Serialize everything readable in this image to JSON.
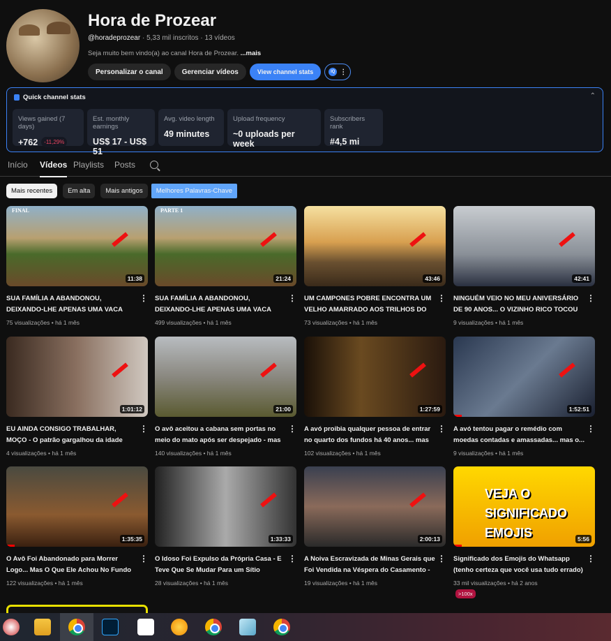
{
  "channel": {
    "name": "Hora de Prozear",
    "handle": "@horadeprozear",
    "subs": " · 5,33 mil inscritos · 13 vídeos",
    "description": "Seja muito bem vindo(a) ao canal Hora de Prozear. ",
    "more": "...mais"
  },
  "buttons": {
    "customize": "Personalizar o canal",
    "manage": "Gerenciar vídeos",
    "stats": "View channel stats",
    "vq": "IQ",
    "more": "⋮"
  },
  "stats": {
    "title": "Quick channel stats",
    "cards": [
      {
        "label": "Views gained (7 days)",
        "value": "+762",
        "badge": "-11,29%"
      },
      {
        "label": "Est. monthly earnings",
        "value": "US$ 17 - US$ 51"
      },
      {
        "label": "Avg. video length",
        "value": "49 minutes"
      },
      {
        "label": "Upload frequency",
        "value": "~0 uploads per week"
      },
      {
        "label": "Subscribers rank",
        "value": "#4,5 mi"
      }
    ]
  },
  "tabs": [
    "Início",
    "Vídeos",
    "Playlists",
    "Posts"
  ],
  "chips": [
    "Mais recentes",
    "Em alta",
    "Mais antigos",
    "Melhores Palavras-Chave"
  ],
  "videos": [
    {
      "title": "SUA FAMÍLIA A ABANDONOU, DEIXANDO-LHE APENAS UMA VACA COMO HERANÇA...",
      "meta": "75 visualizações • há 1 mês",
      "duration": "11:38",
      "label": "FINAL"
    },
    {
      "title": "SUA FAMÍLIA A ABANDONOU, DEIXANDO-LHE APENAS UMA VACA COMO HERANÇA...",
      "meta": "499 visualizações • há 1 mês",
      "duration": "21:24",
      "label": "PARTE 1"
    },
    {
      "title": "UM CAMPONES POBRE ENCONTRA UM VELHO AMARRADO AOS TRILHOS DO TRE...",
      "meta": "73 visualizações • há 1 mês",
      "duration": "43:46"
    },
    {
      "title": "NINGUÉM VEIO NO MEU ANIVERSÁRIO DE 90 ANOS... O VIZINHO RICO TOCOU A...",
      "meta": "9 visualizações • há 1 mês",
      "duration": "42:41"
    },
    {
      "title": "EU AINDA CONSIGO TRABALHAR, MOÇO - O patrão gargalhou da idade dele... até ver o...",
      "meta": "4 visualizações • há 1 mês",
      "duration": "1:01:12"
    },
    {
      "title": "O avô aceitou a cabana sem portas no meio do mato após ser despejado - mas o motiv...",
      "meta": "140 visualizações • há 1 mês",
      "duration": "21:00"
    },
    {
      "title": "A avó proibia qualquer pessoa de entrar no quarto dos fundos há 40 anos... mas quand...",
      "meta": "102 visualizações • há 1 mês",
      "duration": "1:27:59"
    },
    {
      "title": "A avó tentou pagar o remédio com moedas contadas e amassadas... mas o...",
      "meta": "9 visualizações • há 1 mês",
      "duration": "1:52:51"
    },
    {
      "title": "O Avô Foi Abandonado para Morrer Logo... Mas O Que Ele Achou No Fundo do Sítio...",
      "meta": "122 visualizações • há 1 mês",
      "duration": "1:35:35"
    },
    {
      "title": "O Idoso Foi Expulso da Própria Casa - E Teve Que Se Mudar Para um Sítio Abandonado -...",
      "meta": "28 visualizações • há 1 mês",
      "duration": "1:33:33"
    },
    {
      "title": "A Noiva Escravizada de Minas Gerais que Foi Vendida na Véspera do Casamento - Ela foi...",
      "meta": "19 visualizações • há 1 mês",
      "duration": "2:00:13"
    },
    {
      "title": "Significado dos Emojis do Whatsapp (tenho certeza que você usa tudo errado)",
      "meta": "33 mil visualizações • há 2 anos",
      "duration": "5:56",
      "badge": ">100x",
      "label": "VEJA O SIGNIFICADO EMOJIS"
    }
  ]
}
